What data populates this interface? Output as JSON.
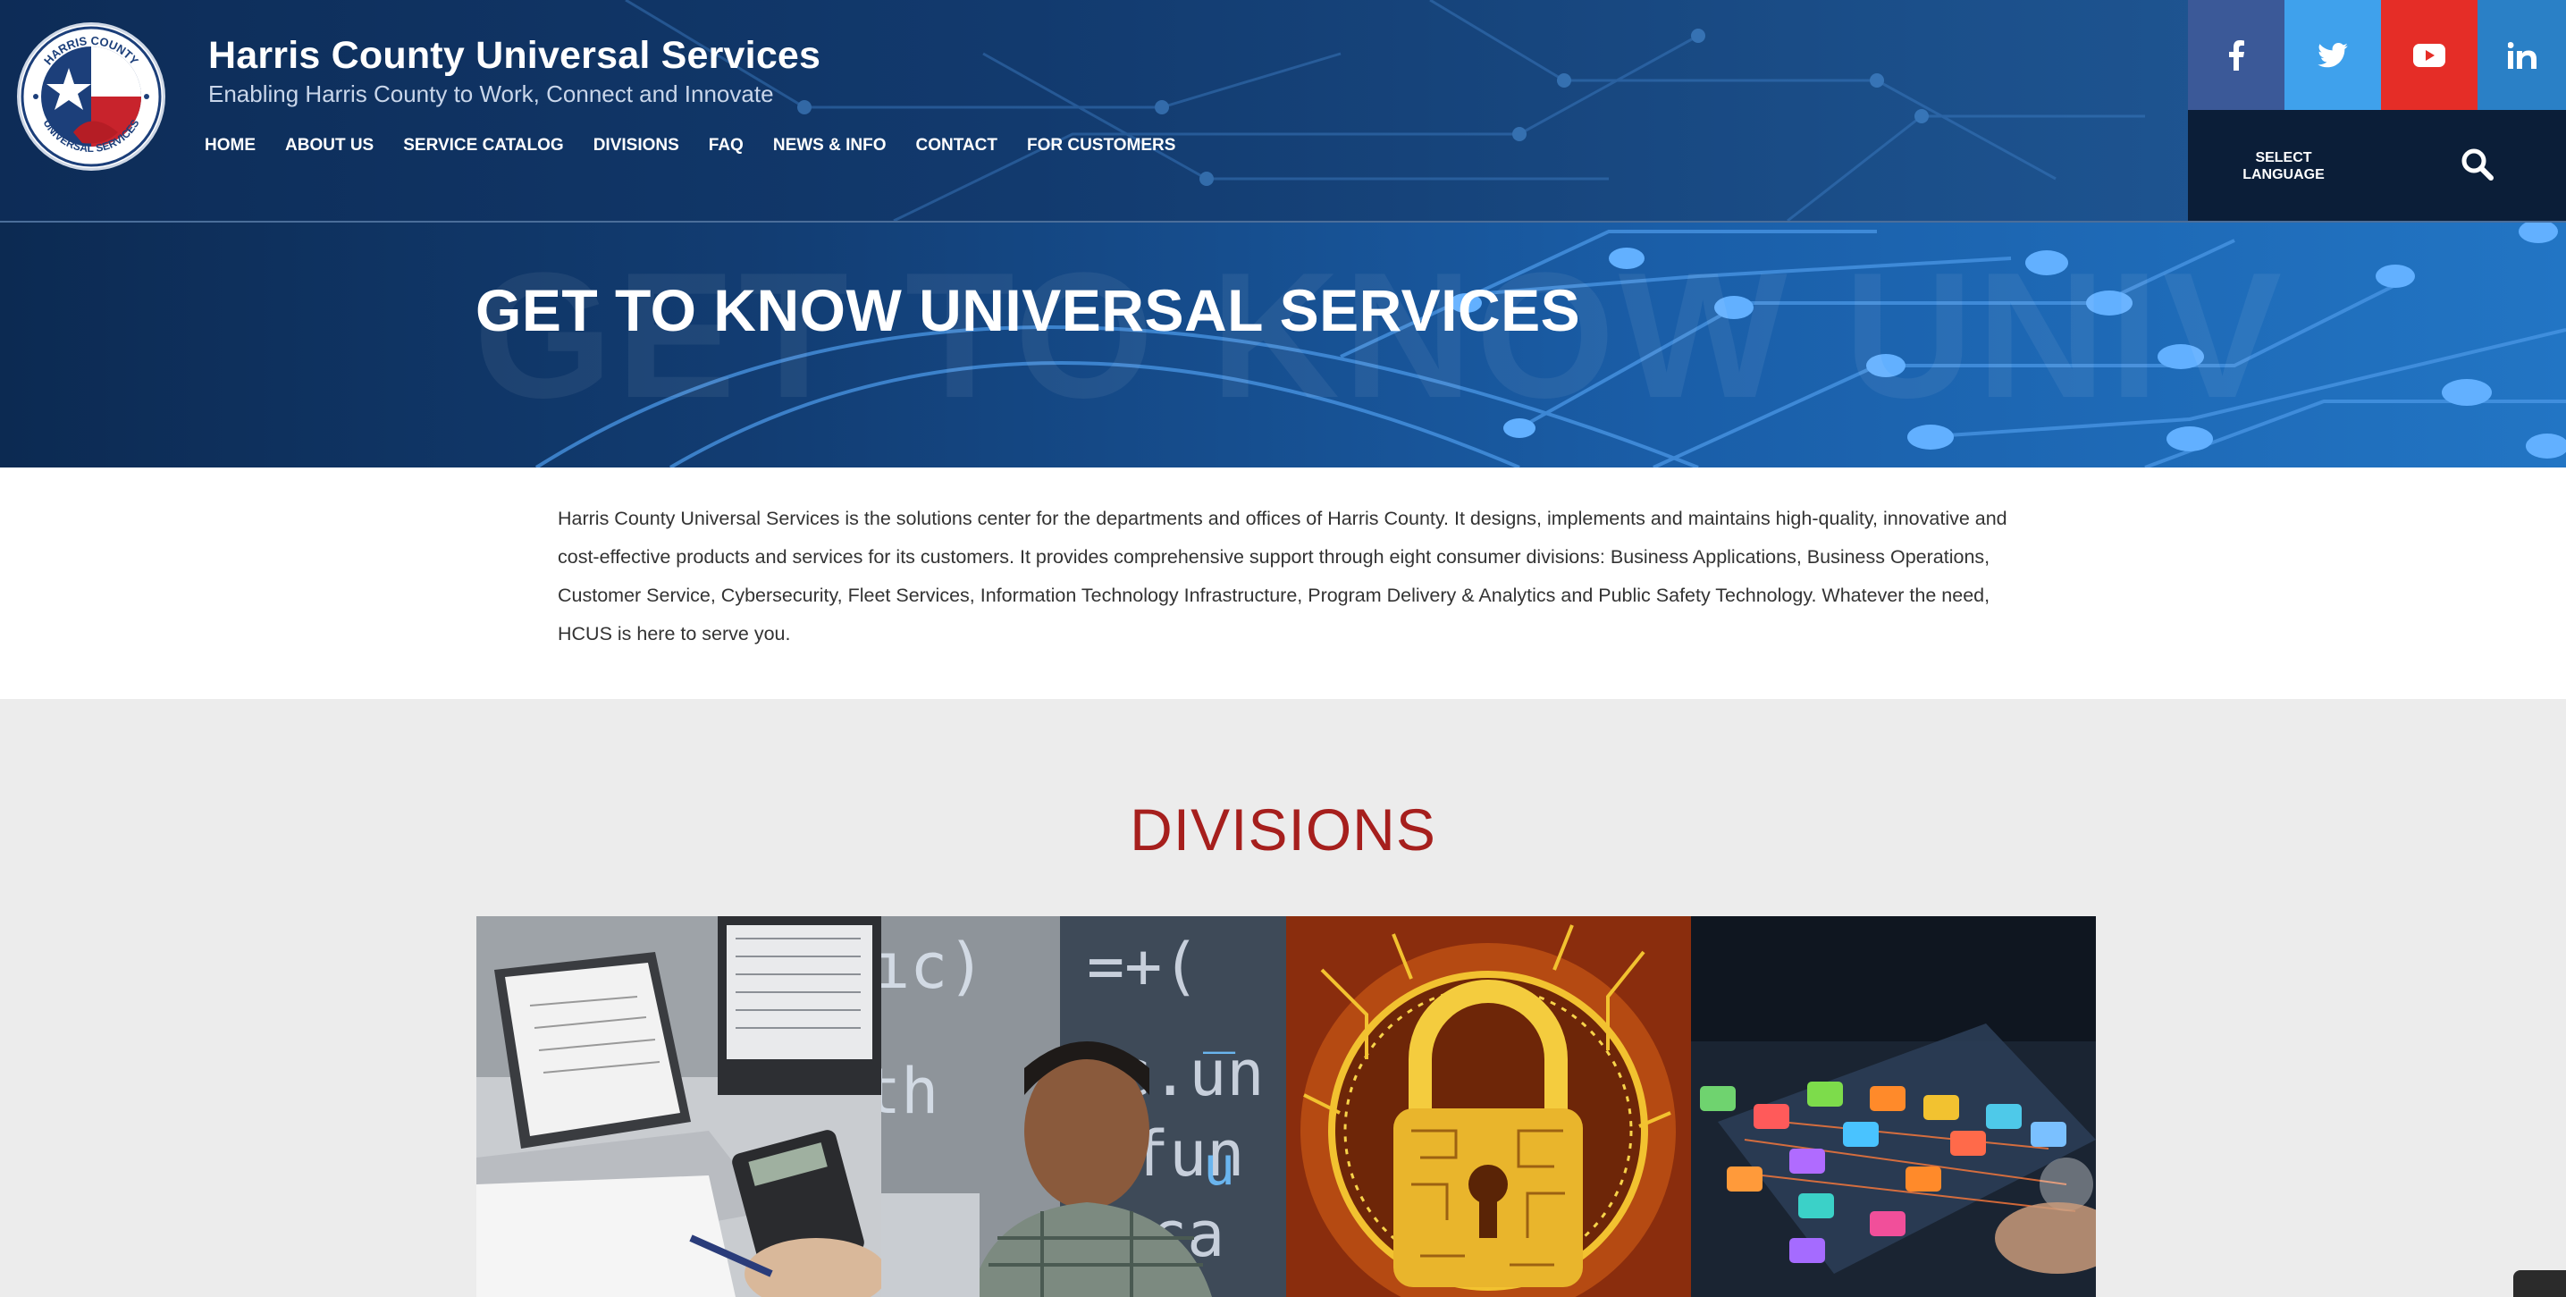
{
  "header": {
    "title": "Harris County Universal Services",
    "tagline": "Enabling Harris County to Work, Connect and Innovate",
    "logo_text_top": "HARRIS COUNTY",
    "logo_text_bottom": "UNIVERSAL SERVICES",
    "nav": [
      {
        "label": "HOME"
      },
      {
        "label": "ABOUT US"
      },
      {
        "label": "SERVICE CATALOG"
      },
      {
        "label": "DIVISIONS"
      },
      {
        "label": "FAQ"
      },
      {
        "label": "NEWS & INFO"
      },
      {
        "label": "CONTACT"
      },
      {
        "label": "FOR CUSTOMERS"
      }
    ],
    "social": [
      {
        "name": "facebook-icon",
        "color": "#3b5998"
      },
      {
        "name": "twitter-icon",
        "color": "#3fa1ec"
      },
      {
        "name": "youtube-icon",
        "color": "#e52d27"
      },
      {
        "name": "linkedin-icon",
        "color": "#2a80c6"
      }
    ],
    "select_language": "SELECT LANGUAGE",
    "search_icon": "search-icon"
  },
  "hero": {
    "title": "GET TO KNOW UNIVERSAL SERVICES",
    "watermark": "GET TO KNOW UNIV"
  },
  "intro": {
    "text": "Harris County Universal Services is the solutions center for the departments and offices of Harris County. It designs, implements and maintains high-quality, innovative and cost-effective products and services for its customers. It provides comprehensive support through eight consumer divisions: Business Applications, Business Operations, Customer Service, Cybersecurity, Fleet Services, Information Technology Infrastructure, Program Delivery & Analytics and Public Safety Technology. Whatever the need, HCUS is here to serve you."
  },
  "divisions": {
    "title": "DIVISIONS",
    "tiles": [
      {
        "image": "business-operations-image"
      },
      {
        "image": "business-applications-image"
      },
      {
        "image": "cybersecurity-image"
      },
      {
        "image": "information-technology-image"
      }
    ]
  },
  "colors": {
    "header_bg": "#0d2c57",
    "divisions_title": "#a61f1d",
    "intro_text": "#333333",
    "page_bg": "#ececec"
  }
}
